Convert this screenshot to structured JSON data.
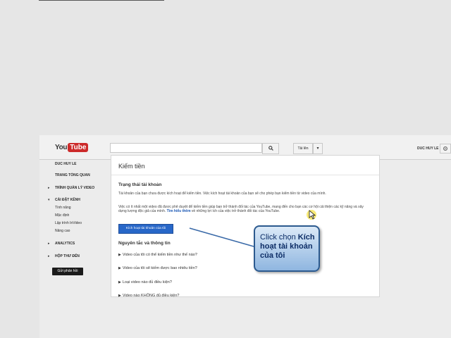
{
  "header": {
    "logo_you": "You",
    "logo_tube": "Tube",
    "upload_label": "Tải lên",
    "username": "DUC HUY LE"
  },
  "sidebar": {
    "username": "DUC HUY LE",
    "dashboard": "TRANG TỔNG QUAN",
    "video_manager": "TRÌNH QUẢN LÝ VIDEO",
    "channel_settings": "CÀI ĐẶT KÊNH",
    "sub_items": [
      "Tính năng",
      "Mặc định",
      "Lập trình InVideo",
      "Nâng cao"
    ],
    "analytics": "ANALYTICS",
    "inbox": "HỘP THƯ ĐẾN",
    "feedback": "Gửi phản hồi"
  },
  "content": {
    "title": "Kiếm tiền",
    "status_heading": "Trạng thái tài khoản",
    "para1": "Tài khoản của bạn chưa được kích hoạt để kiếm tiền. Việc kích hoạt tài khoản của bạn sẽ cho phép bạn kiếm tiền từ video của mình.",
    "para2_before": "Việc có ít nhất một video đã được phê duyệt để kiếm tiền giúp bạn trở thành đối tác của YouTube, mang đến cho bạn các cơ hội cải thiện các kỹ năng và xây dựng lượng độc giả của mình.",
    "para2_link": "Tìm hiểu thêm",
    "para2_after": "về những lợi ích của việc trở thành đối tác của YouTube.",
    "activate_button": "Kích hoạt tài khoản của tôi",
    "rules_heading": "Nguyên tắc và thông tin",
    "faq": [
      "Video của tôi có thể kiếm tiền như thế nào?",
      "Video của tôi sẽ kiếm được bao nhiêu tiền?",
      "Loại video nào đủ điều kiện?",
      "Video nào KHÔNG đủ điều kiện?"
    ]
  },
  "callout": {
    "prefix": "Click chọn ",
    "bold": "Kích hoạt tài khoản của tôi"
  },
  "icons": [
    "search-icon",
    "chevron-down-icon",
    "gear-icon",
    "arrow-right-icon",
    "cursor-icon"
  ]
}
